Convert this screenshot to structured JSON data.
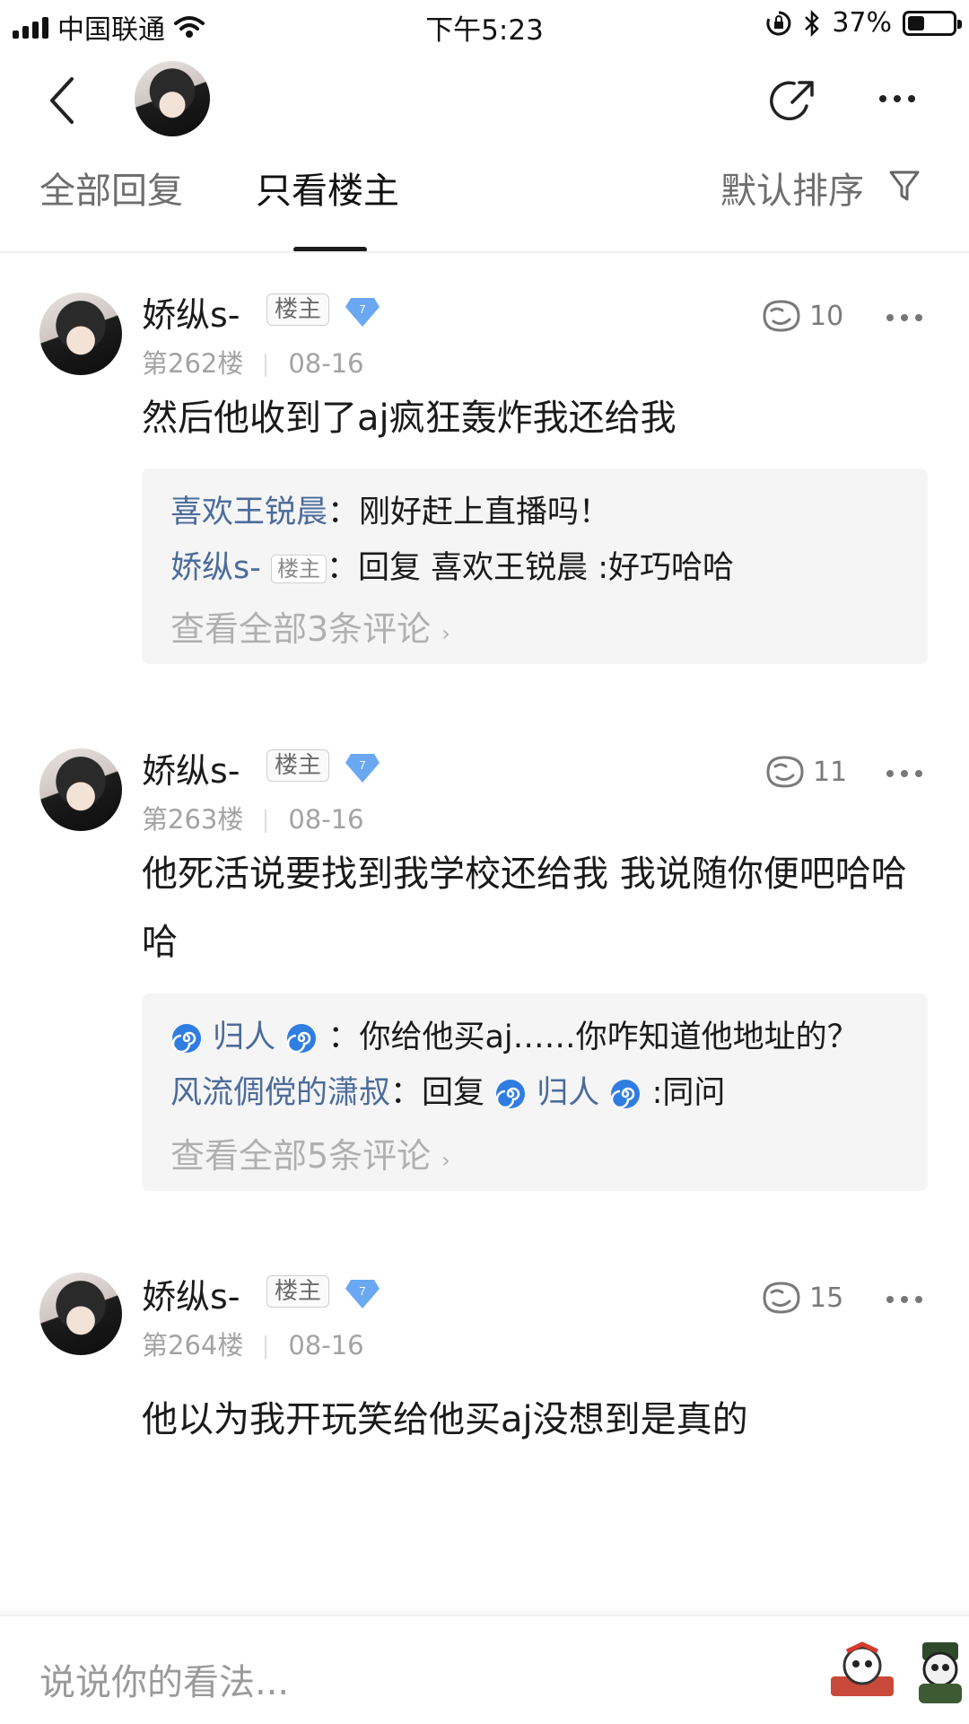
{
  "status_bar": {
    "carrier": "中国联通",
    "time": "下午5:23",
    "battery_text": "37%",
    "battery_level": 0.37
  },
  "tabs": [
    {
      "label": "全部回复",
      "active": false
    },
    {
      "label": "只看楼主",
      "active": true
    }
  ],
  "sort": {
    "label": "默认排序"
  },
  "posts": [
    {
      "author": "娇纵s-",
      "badge": "楼主",
      "level": "7",
      "floor": "第262楼",
      "date": "08-16",
      "likes": "10",
      "content": "然后他收到了aj疯狂轰炸我还给我",
      "replies": [
        {
          "user": "喜欢王锐晨",
          "text": "：刚好赶上直播吗！"
        },
        {
          "user": "娇纵s-",
          "badge": "楼主",
          "text": "：回复 喜欢王锐晨 :好巧哈哈"
        }
      ],
      "view_all": "查看全部3条评论"
    },
    {
      "author": "娇纵s-",
      "badge": "楼主",
      "level": "7",
      "floor": "第263楼",
      "date": "08-16",
      "likes": "11",
      "content": "他死活说要找到我学校还给我 我说随你便吧哈哈哈",
      "replies": [
        {
          "user": "归人",
          "text": "：你给他买aj……你咋知道他地址的？"
        },
        {
          "user": "风流倜傥的潇叔",
          "text": "：回复 ",
          "mention": "归人",
          "text2": " :同问"
        }
      ],
      "view_all": "查看全部5条评论"
    },
    {
      "author": "娇纵s-",
      "badge": "楼主",
      "level": "7",
      "floor": "第264楼",
      "date": "08-16",
      "likes": "15",
      "content": "他以为我开玩笑给他买aj没想到是真的"
    }
  ],
  "composer": {
    "placeholder": "说说你的看法..."
  },
  "icons": [
    "signal-icon",
    "wifi-icon",
    "orientation-lock-icon",
    "bluetooth-icon",
    "battery-icon",
    "back-icon",
    "share-icon",
    "more-icon",
    "filter-icon",
    "like-icon",
    "level-diamond-icon",
    "swirl-emoji-icon",
    "sticker-icon"
  ]
}
